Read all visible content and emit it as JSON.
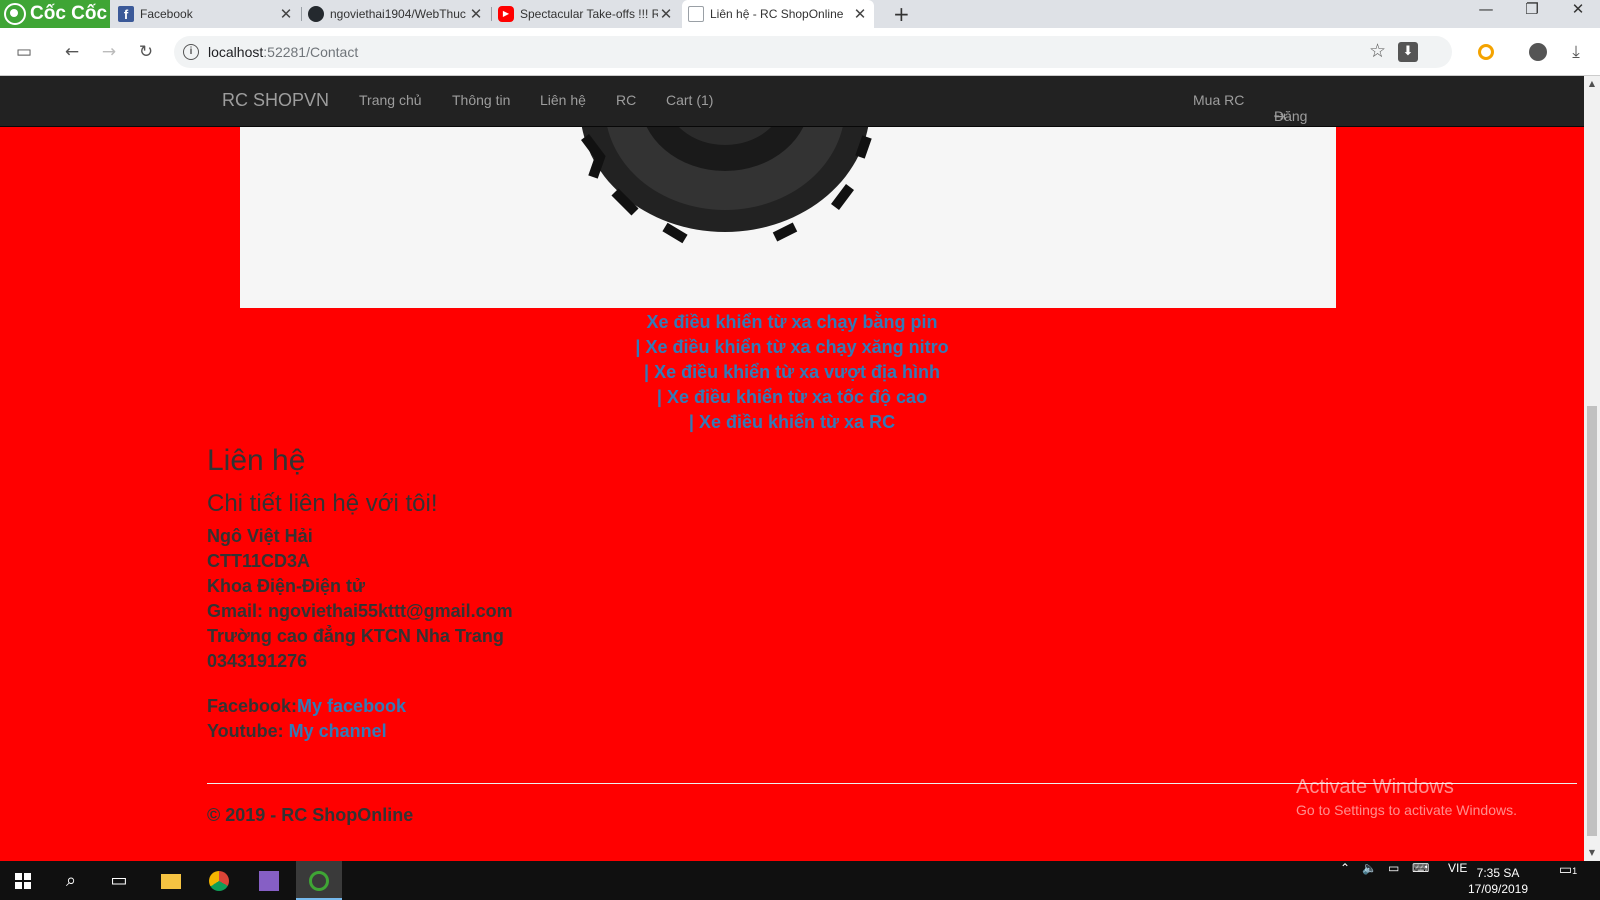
{
  "browser": {
    "brand": "Cốc Cốc",
    "tabs": [
      {
        "title": "Facebook",
        "active": false
      },
      {
        "title": "ngoviethai1904/WebThuc",
        "active": false
      },
      {
        "title": "Spectacular Take-offs !!! R",
        "active": false
      },
      {
        "title": "Liên hệ - RC ShopOnline",
        "active": true
      }
    ],
    "new_tab": "+",
    "url_host": "localhost",
    "url_path": ":52281/Contact",
    "window_controls": {
      "minimize": "—",
      "restore": "❐",
      "close": "✕"
    }
  },
  "navbar": {
    "brand": "RC SHOPVN",
    "items": [
      "Trang chủ",
      "Thông tin",
      "Liên hệ",
      "RC",
      "Cart (1)"
    ],
    "right_items": [
      "Mua RC",
      "Đăng Nhập"
    ]
  },
  "categories": {
    "separator": "|",
    "links": [
      "Xe điều khiển từ xa chạy bằng pin",
      "Xe điều khiển từ xa chạy xăng nitro",
      "Xe điều khiển từ xa vượt địa hình",
      "Xe điều khiển từ xa tốc độ cao",
      "Xe điều khiển từ xa RC"
    ]
  },
  "contact": {
    "title": "Liên hệ",
    "subtitle": "Chi tiết liên hệ với tôi!",
    "address_lines": [
      "Ngô Việt Hải",
      "CTT11CD3A",
      "Khoa Điện-Điện tử",
      "Gmail: ngoviethai55kttt@gmail.com",
      "Trường cao đẳng KTCN Nha Trang",
      "0343191276"
    ],
    "facebook_label": "Facebook:",
    "facebook_link": "My facebook",
    "youtube_label": "Youtube: ",
    "youtube_link": "My channel"
  },
  "footer": {
    "copyright": "© 2019 - RC ShopOnline"
  },
  "watermark": {
    "line1": "Activate Windows",
    "line2": "Go to Settings to activate Windows."
  },
  "taskbar": {
    "language": "VIE",
    "time": "7:35 SA",
    "date": "17/09/2019",
    "notification_count": "1"
  },
  "colors": {
    "page_bg": "#ff0000",
    "navbar_bg": "#222222",
    "link": "#337ab7",
    "text": "#333333"
  }
}
